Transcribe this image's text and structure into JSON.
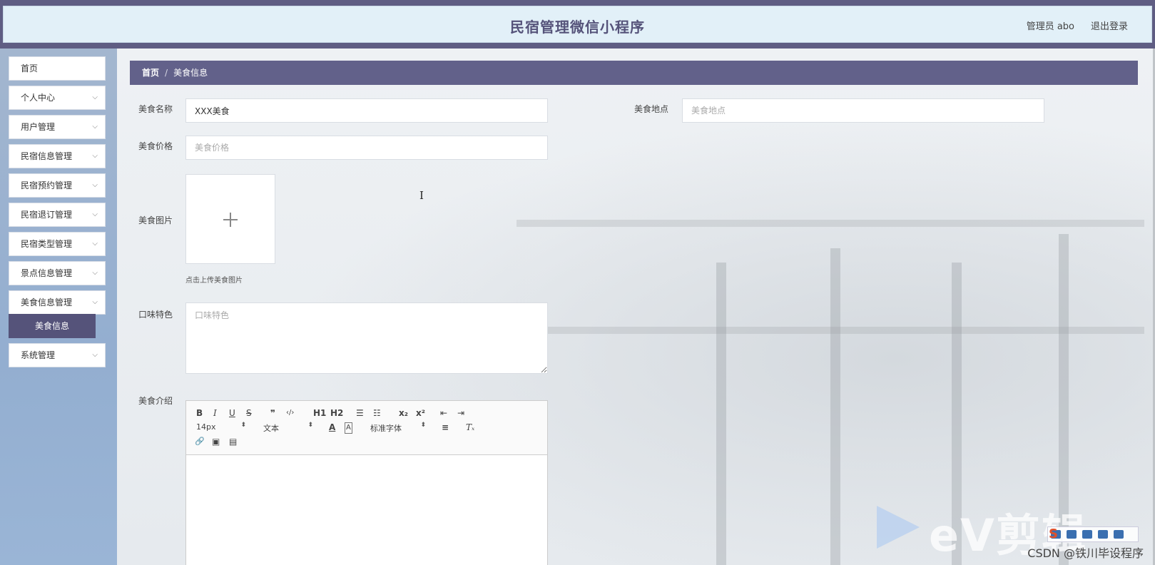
{
  "header": {
    "title": "民宿管理微信小程序",
    "user": "管理员 abo",
    "logout": "退出登录"
  },
  "sidebar": {
    "items": [
      {
        "label": "首页",
        "expandable": false
      },
      {
        "label": "个人中心",
        "expandable": true
      },
      {
        "label": "用户管理",
        "expandable": true
      },
      {
        "label": "民宿信息管理",
        "expandable": true
      },
      {
        "label": "民宿预约管理",
        "expandable": true
      },
      {
        "label": "民宿退订管理",
        "expandable": true
      },
      {
        "label": "民宿类型管理",
        "expandable": true
      },
      {
        "label": "景点信息管理",
        "expandable": true
      },
      {
        "label": "美食信息管理",
        "expandable": true,
        "expanded": true
      },
      {
        "label": "系统管理",
        "expandable": true
      }
    ],
    "active_sub": "美食信息",
    "chevron": "⌵"
  },
  "breadcrumb": {
    "home": "首页",
    "separator": "/",
    "current": "美食信息"
  },
  "form": {
    "name": {
      "label": "美食名称",
      "value": "XXX美食",
      "placeholder": "美食名称"
    },
    "location": {
      "label": "美食地点",
      "value": "",
      "placeholder": "美食地点"
    },
    "price": {
      "label": "美食价格",
      "value": "",
      "placeholder": "美食价格"
    },
    "image": {
      "label": "美食图片",
      "hint": "点击上传美食图片",
      "plus": "+"
    },
    "taste": {
      "label": "口味特色",
      "value": "",
      "placeholder": "口味特色"
    },
    "intro": {
      "label": "美食介绍"
    }
  },
  "editor": {
    "toolbar": {
      "bold": "B",
      "italic": "I",
      "underline": "U",
      "strike": "S",
      "blockquote": "❞",
      "code": "‹/›",
      "h1": "H1",
      "h2": "H2",
      "ordered_list": "☰",
      "bullet_list": "☷",
      "subscript": "x₂",
      "superscript": "x²",
      "outdent": "⇤",
      "indent": "⇥",
      "size": "14px",
      "header_select": "文本",
      "font_select": "标准字体",
      "select_arrow": "⬍",
      "color": "A",
      "background": "A",
      "align": "≡",
      "clean": "Tₓ",
      "link": "🔗",
      "image": "▣",
      "video": "▤"
    }
  },
  "watermark": {
    "brand": "eV剪辑",
    "csdn": "CSDN @铁川毕设程序",
    "s_logo": "S"
  },
  "colors": {
    "primary": "#62618a",
    "header_bg": "#e2f0f8",
    "sidebar_bg": "#9ab1cf",
    "active_sub_bg": "#55537a"
  }
}
